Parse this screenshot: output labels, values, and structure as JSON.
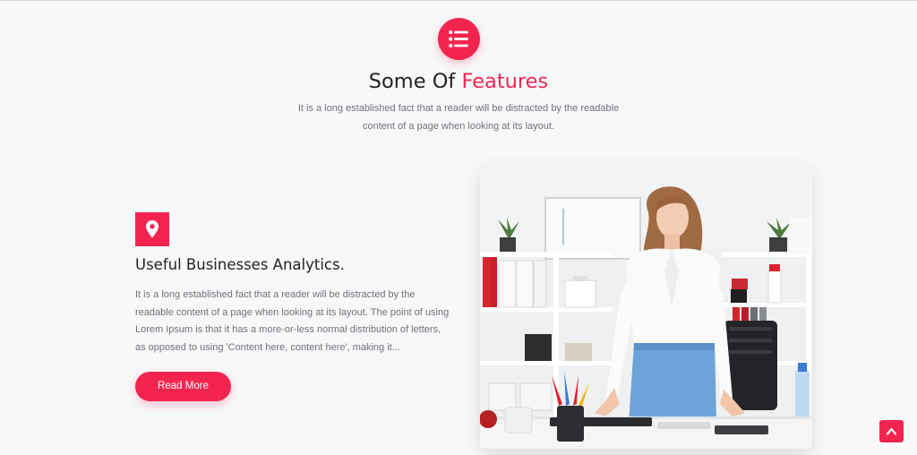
{
  "header": {
    "icon": "list-icon",
    "title_main": "Some Of ",
    "title_accent": "Features",
    "subtitle_line1": "It is a long established fact that a reader will be distracted by the readable",
    "subtitle_line2": "content of a page when looking at its layout."
  },
  "feature": {
    "icon": "map-pin-icon",
    "title": "Useful Businesses Analytics.",
    "text_lines": [
      "It is a long established fact that a reader will be distracted by the",
      "readable content of a page when looking at its layout. The point of using",
      "Lorem Ipsum is that it has a more-or-less normal distribution of letters,",
      "as opposed to using 'Content here, content here', making it..."
    ],
    "button_label": "Read More",
    "image": "woman-at-office-desk-photo"
  },
  "back_to_top": {
    "icon": "chevron-up-icon"
  },
  "colors": {
    "accent": "#f3254f",
    "background": "#f7f8fa",
    "heading": "#222222",
    "body_text": "#6f7276"
  }
}
